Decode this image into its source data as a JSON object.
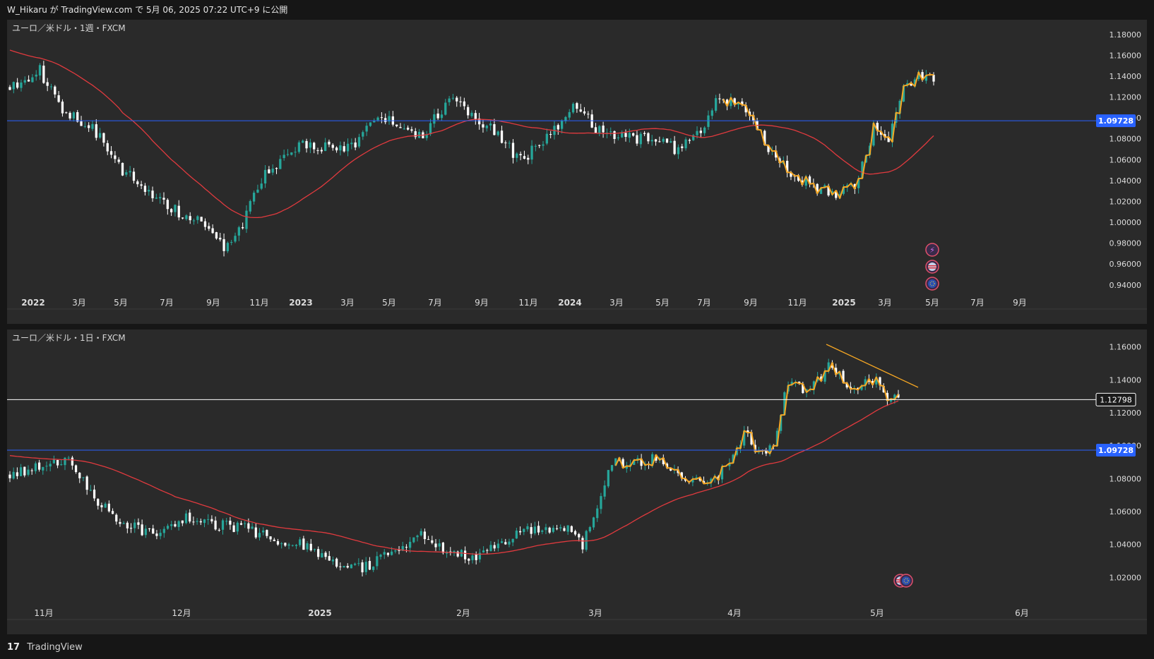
{
  "header": {
    "text": "W_Hikaru が TradingView.com で 5月 06, 2025 07:22 UTC+9 に公開"
  },
  "footer": {
    "brand": "TradingView",
    "logo_icon": "tradingview-logo-icon"
  },
  "colors": {
    "background": "#161616",
    "panel": "#2a2a2a",
    "bull": "#26a69a",
    "bear": "#ffffff",
    "ma": "#e03a3e",
    "blue_line": "#2962ff",
    "white_line": "#ffffff",
    "drawing": "#f5a623"
  },
  "chart_data": [
    {
      "type": "candlestick",
      "title": "ユーロ／米ドル・1週・FXCM",
      "symbol": "EUR/USD",
      "interval": "1週",
      "source": "FXCM",
      "ylim": [
        0.925,
        1.19
      ],
      "y_ticks": [
        "1.18000",
        "1.16000",
        "1.14000",
        "1.12000",
        "1.10000",
        "1.08000",
        "1.06000",
        "1.04000",
        "1.02000",
        "1.00000",
        "0.98000",
        "0.96000",
        "0.94000"
      ],
      "x_ticks": [
        {
          "label": "2022",
          "bold": true
        },
        {
          "label": "3月"
        },
        {
          "label": "5月"
        },
        {
          "label": "7月"
        },
        {
          "label": "9月"
        },
        {
          "label": "11月"
        },
        {
          "label": "2023",
          "bold": true
        },
        {
          "label": "3月"
        },
        {
          "label": "5月"
        },
        {
          "label": "7月"
        },
        {
          "label": "9月"
        },
        {
          "label": "11月"
        },
        {
          "label": "2024",
          "bold": true
        },
        {
          "label": "3月"
        },
        {
          "label": "5月"
        },
        {
          "label": "7月"
        },
        {
          "label": "9月"
        },
        {
          "label": "11月"
        },
        {
          "label": "2025",
          "bold": true
        },
        {
          "label": "3月"
        },
        {
          "label": "5月"
        },
        {
          "label": "7月"
        },
        {
          "label": "9月"
        }
      ],
      "anchors": [
        [
          0,
          1.13
        ],
        [
          8,
          1.145
        ],
        [
          14,
          1.11
        ],
        [
          22,
          1.09
        ],
        [
          30,
          1.05
        ],
        [
          40,
          1.02
        ],
        [
          50,
          1.0
        ],
        [
          58,
          0.975
        ],
        [
          62,
          1.0
        ],
        [
          68,
          1.045
        ],
        [
          78,
          1.075
        ],
        [
          90,
          1.07
        ],
        [
          98,
          1.1
        ],
        [
          110,
          1.085
        ],
        [
          118,
          1.12
        ],
        [
          128,
          1.09
        ],
        [
          136,
          1.06
        ],
        [
          142,
          1.075
        ],
        [
          150,
          1.11
        ],
        [
          158,
          1.085
        ],
        [
          168,
          1.08
        ],
        [
          178,
          1.07
        ],
        [
          184,
          1.085
        ],
        [
          188,
          1.12
        ],
        [
          196,
          1.11
        ],
        [
          202,
          1.07
        ],
        [
          208,
          1.045
        ],
        [
          214,
          1.035
        ],
        [
          220,
          1.025
        ],
        [
          226,
          1.04
        ],
        [
          230,
          1.09
        ],
        [
          234,
          1.08
        ],
        [
          238,
          1.13
        ],
        [
          243,
          1.14
        ],
        [
          246,
          1.134
        ]
      ],
      "price_line": {
        "label": "1.09728",
        "value": 1.09728,
        "color": "#2962ff"
      },
      "moving_average": "red",
      "events": [
        "lightning-event-icon",
        "us-flag-icon",
        "eu-flag-icon"
      ]
    },
    {
      "type": "candlestick",
      "title": "ユーロ／米ドル・1日・FXCM",
      "symbol": "EUR/USD",
      "interval": "1日",
      "source": "FXCM",
      "ylim": [
        1.0,
        1.168
      ],
      "y_ticks": [
        "1.16000",
        "1.14000",
        "1.12000",
        "1.10000",
        "1.08000",
        "1.06000",
        "1.04000",
        "1.02000"
      ],
      "x_ticks": [
        {
          "label": "11月"
        },
        {
          "label": "12月"
        },
        {
          "label": "2025",
          "bold": true
        },
        {
          "label": "2月"
        },
        {
          "label": "3月"
        },
        {
          "label": "4月"
        },
        {
          "label": "5月"
        },
        {
          "label": "6月"
        }
      ],
      "anchors": [
        [
          0,
          1.082
        ],
        [
          10,
          1.088
        ],
        [
          16,
          1.09
        ],
        [
          24,
          1.065
        ],
        [
          32,
          1.052
        ],
        [
          40,
          1.045
        ],
        [
          48,
          1.058
        ],
        [
          56,
          1.052
        ],
        [
          64,
          1.05
        ],
        [
          72,
          1.043
        ],
        [
          80,
          1.04
        ],
        [
          88,
          1.028
        ],
        [
          96,
          1.025
        ],
        [
          104,
          1.035
        ],
        [
          112,
          1.045
        ],
        [
          120,
          1.035
        ],
        [
          128,
          1.032
        ],
        [
          136,
          1.045
        ],
        [
          144,
          1.05
        ],
        [
          152,
          1.05
        ],
        [
          156,
          1.04
        ],
        [
          160,
          1.06
        ],
        [
          164,
          1.09
        ],
        [
          168,
          1.088
        ],
        [
          176,
          1.092
        ],
        [
          184,
          1.08
        ],
        [
          190,
          1.078
        ],
        [
          196,
          1.087
        ],
        [
          200,
          1.108
        ],
        [
          204,
          1.095
        ],
        [
          208,
          1.1
        ],
        [
          212,
          1.14
        ],
        [
          216,
          1.135
        ],
        [
          220,
          1.14
        ],
        [
          224,
          1.15
        ],
        [
          228,
          1.136
        ],
        [
          232,
          1.137
        ],
        [
          236,
          1.14
        ],
        [
          238,
          1.13
        ],
        [
          242,
          1.132
        ]
      ],
      "price_lines": [
        {
          "label": "1.12798",
          "value": 1.12798,
          "color": "#ffffff"
        },
        {
          "label": "1.09728",
          "value": 1.09728,
          "color": "#2962ff"
        }
      ],
      "moving_average": "red",
      "events": [
        "us-flag-icon",
        "eu-flag-icon"
      ]
    }
  ]
}
